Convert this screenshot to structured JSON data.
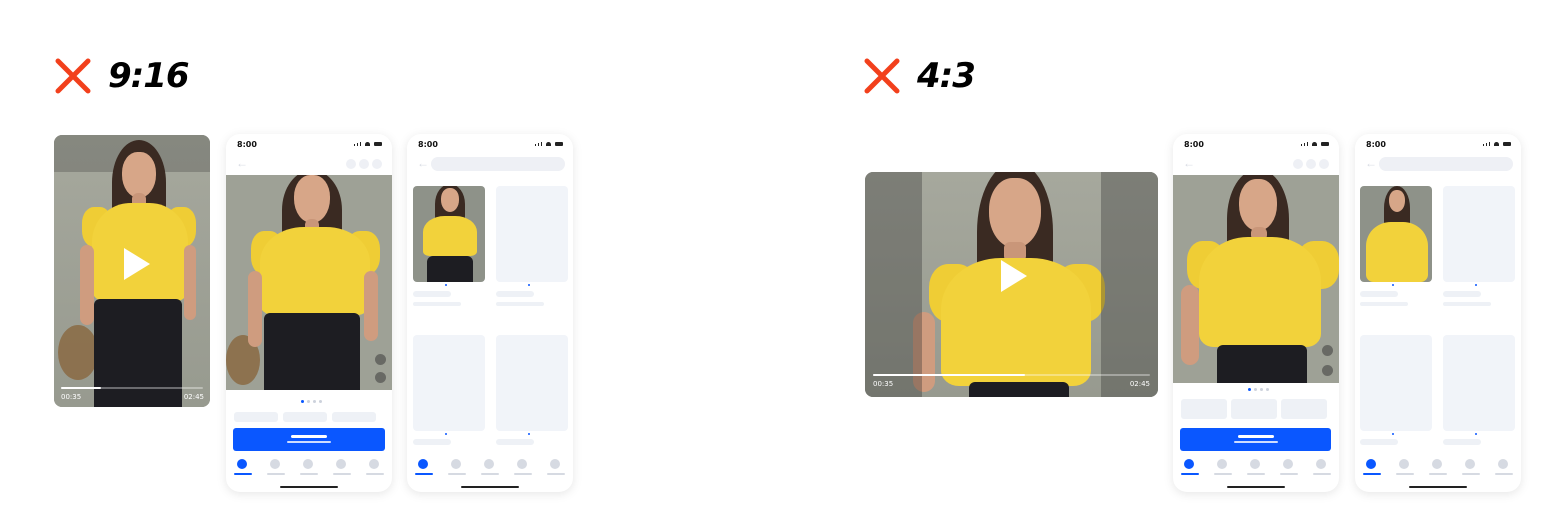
{
  "colors": {
    "error_x": "#f2401c",
    "primary": "#0a57ff",
    "skeleton": "#eef1f6",
    "shirt": "#f2d23b"
  },
  "left_example": {
    "ratio_label": "9:16",
    "icon": "cross-icon",
    "video": {
      "current_time": "00:35",
      "duration": "02:45",
      "progress": 0.28
    },
    "phone_detail": {
      "clock": "8:00"
    },
    "phone_grid": {
      "clock": "8:00"
    }
  },
  "right_example": {
    "ratio_label": "4:3",
    "icon": "cross-icon",
    "video": {
      "current_time": "00:35",
      "duration": "02:45",
      "progress": 0.55
    },
    "phone_detail": {
      "clock": "8:00"
    },
    "phone_grid": {
      "clock": "8:00"
    }
  }
}
